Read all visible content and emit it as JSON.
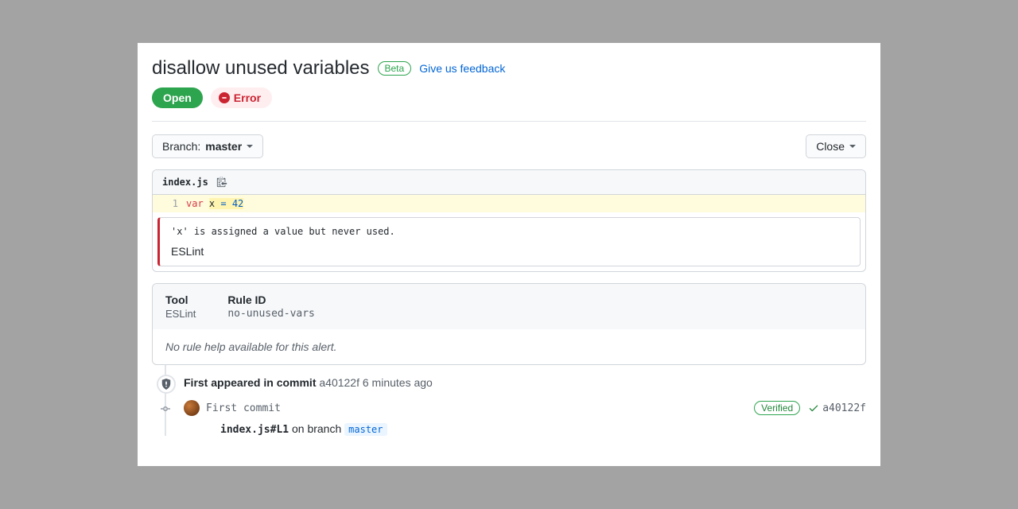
{
  "header": {
    "title": "disallow unused variables",
    "beta_label": "Beta",
    "feedback_label": "Give us feedback"
  },
  "status": {
    "open_label": "Open",
    "error_label": "Error"
  },
  "toolbar": {
    "branch_prefix": "Branch: ",
    "branch_name": "master",
    "close_label": "Close"
  },
  "file": {
    "name": "index.js",
    "line_number": "1",
    "code_keyword": "var",
    "code_var": "x",
    "code_rest": " = 42"
  },
  "message": {
    "text": "'x' is assigned a value but never used.",
    "tool": "ESLint"
  },
  "details": {
    "tool_label": "Tool",
    "tool_value": "ESLint",
    "rule_label": "Rule ID",
    "rule_value": "no-unused-vars",
    "help_text": "No rule help available for this alert."
  },
  "timeline": {
    "first_label": "First appeared in commit",
    "first_hash": "a40122f",
    "first_time": "6 minutes ago",
    "commit_message": "First commit",
    "verified_label": "Verified",
    "commit_hash_short": "a40122f",
    "file_link": "index.js#L1",
    "branch_prefix": " on branch ",
    "branch_name": "master"
  }
}
